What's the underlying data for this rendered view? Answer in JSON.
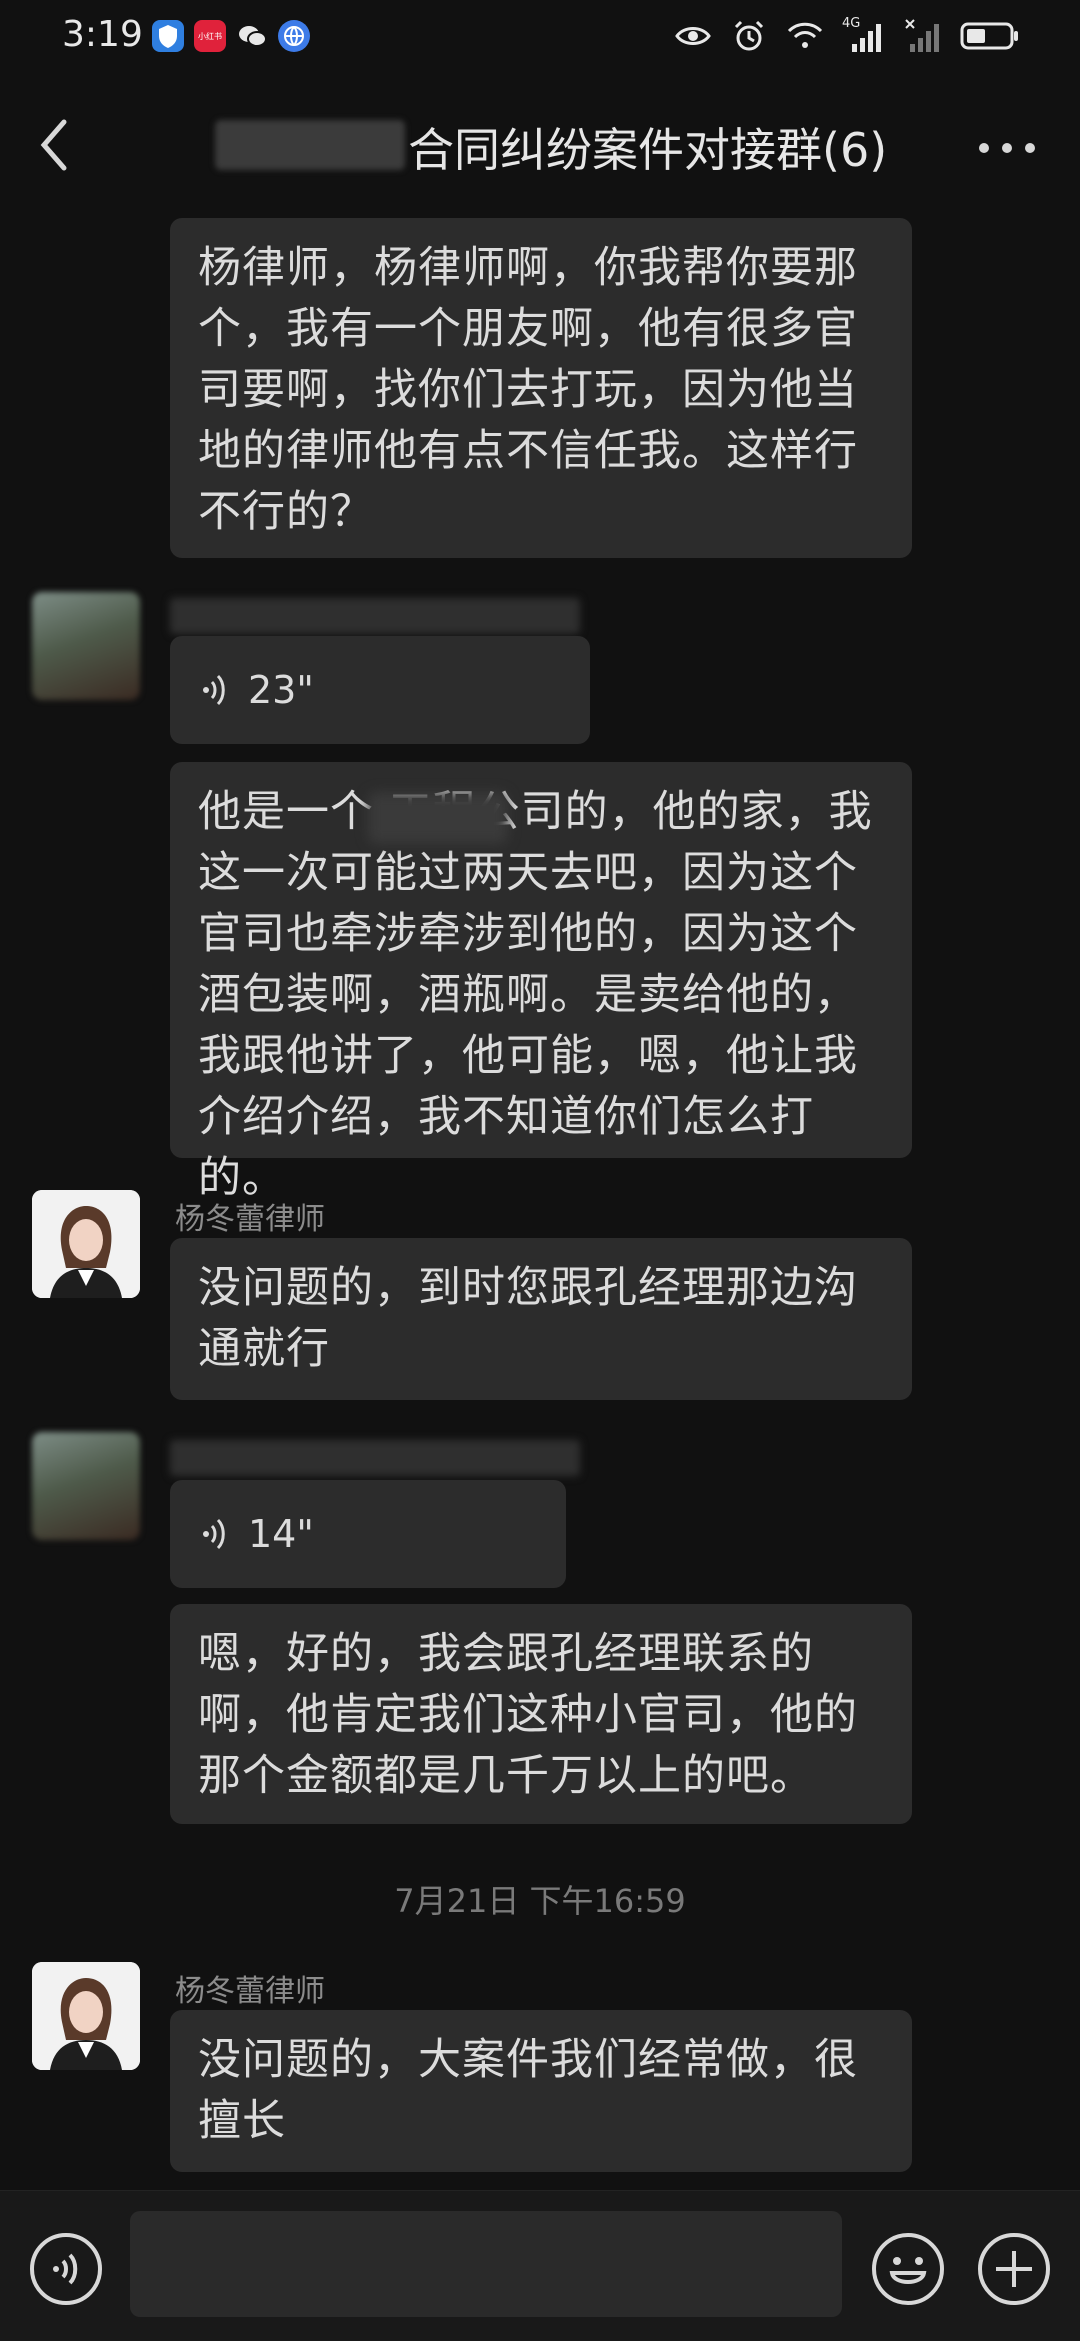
{
  "status_bar": {
    "time": "3:19",
    "network_label": "4G",
    "apps": [
      "shield-app-icon",
      "xiaohongshu-app-icon",
      "wechat-app-icon",
      "browser-app-icon"
    ],
    "xiaohongshu_text": "小红书"
  },
  "header": {
    "title": "合同纠纷案件对接群(6)"
  },
  "messages": [
    {
      "type": "text",
      "text": "杨律师，杨律师啊，你我帮你要那个，我有一个朋友啊，他有很多官司要啊，找你们去打玩，因为他当地的律师他有点不信任我。这样行不行的？"
    },
    {
      "type": "voice",
      "duration": "23\""
    },
    {
      "type": "text",
      "text": "他是一个  工程公司的，他的家，我这一次可能过两天去吧，因为这个官司也牵涉牵涉到他的，因为这个酒包装啊，酒瓶啊。是卖给他的，我跟他讲了，他可能，嗯，他让我介绍介绍，我不知道你们怎么打的。"
    },
    {
      "type": "text",
      "sender": "杨冬蕾律师",
      "text": "没问题的，到时您跟孔经理那边沟通就行"
    },
    {
      "type": "voice",
      "duration": "14\""
    },
    {
      "type": "text",
      "text": "嗯，好的，我会跟孔经理联系的啊，他肯定我们这种小官司，他的那个金额都是几千万以上的吧。"
    },
    {
      "type": "timestamp",
      "text": "7月21日 下午16:59"
    },
    {
      "type": "text",
      "sender": "杨冬蕾律师",
      "text": "没问题的，大案件我们经常做，很擅长"
    }
  ],
  "input_bar": {
    "voice_icon": "voice-input-icon",
    "emoji_icon": "emoji-icon",
    "plus_icon": "plus-icon"
  }
}
